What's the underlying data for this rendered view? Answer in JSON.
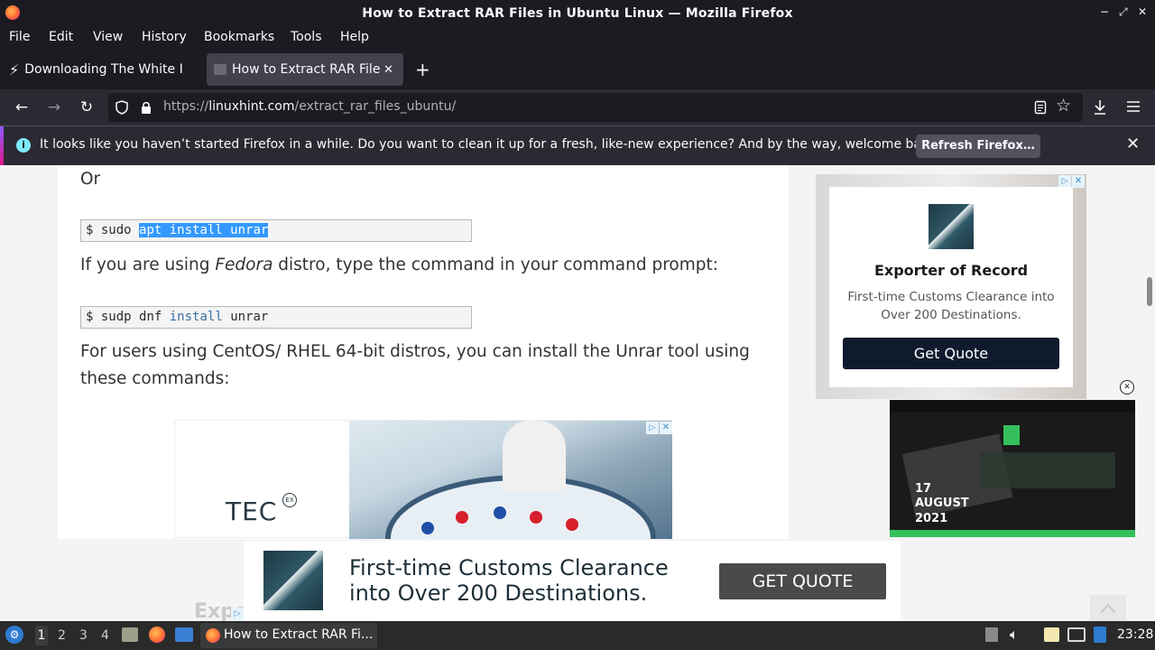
{
  "window": {
    "title": "How to Extract RAR Files in Ubuntu Linux — Mozilla Firefox",
    "controls": [
      "−",
      "⤢",
      "✕"
    ]
  },
  "menu": [
    "File",
    "Edit",
    "View",
    "History",
    "Bookmarks",
    "Tools",
    "Help"
  ],
  "tabs": [
    {
      "label": "Downloading The White I",
      "active": false
    },
    {
      "label": "How to Extract RAR Files",
      "active": true
    }
  ],
  "nav": {
    "url_prefix": "https://",
    "url_domain": "linuxhint.com",
    "url_path": "/extract_rar_files_ubuntu/"
  },
  "notification": {
    "message": "It looks like you haven’t started Firefox in a while. Do you want to clean it up for a fresh, like-new experience? And by the way, welcome back!",
    "button": "Refresh Firefox…"
  },
  "article": {
    "or": "Or",
    "code1": {
      "prompt": "$",
      "cmd": "sudo",
      "selected": "apt install unrar"
    },
    "fedora_pre": "If you are using ",
    "fedora_em": "Fedora",
    "fedora_post": " distro, type the command in your command prompt:",
    "code2": {
      "prompt": "$",
      "cmd": "sudp dnf",
      "kw": "install",
      "arg": "unrar"
    },
    "centos_line1": "For users using CentOS/ RHEL 64-bit distros, you can install the Unrar tool using",
    "centos_line2": "these commands:"
  },
  "inline_ad": {
    "brand": "TEC"
  },
  "sidebar_ad": {
    "heading": "Exporter of Record",
    "body_line1": "First-time Customs Clearance into",
    "body_line2": "Over 200 Destinations.",
    "button": "Get Quote"
  },
  "video_ad": {
    "date_day": "17",
    "date_month": "AUGUST",
    "date_year": "2021"
  },
  "bottom_ad": {
    "line1": "First-time Customs Clearance",
    "line2": "into Over 200 Destinations.",
    "button": "GET QUOTE",
    "partial_text": "Expo"
  },
  "taskbar": {
    "workspaces": [
      "1",
      "2",
      "3",
      "4"
    ],
    "active_window": "How to Extract RAR Fi...",
    "clock": "23:28"
  },
  "colors": {
    "firefox_dark": "#1c1b22",
    "toolbar": "#2b2a33",
    "selection": "#3399ff",
    "ad_button": "#0f1b2d"
  }
}
